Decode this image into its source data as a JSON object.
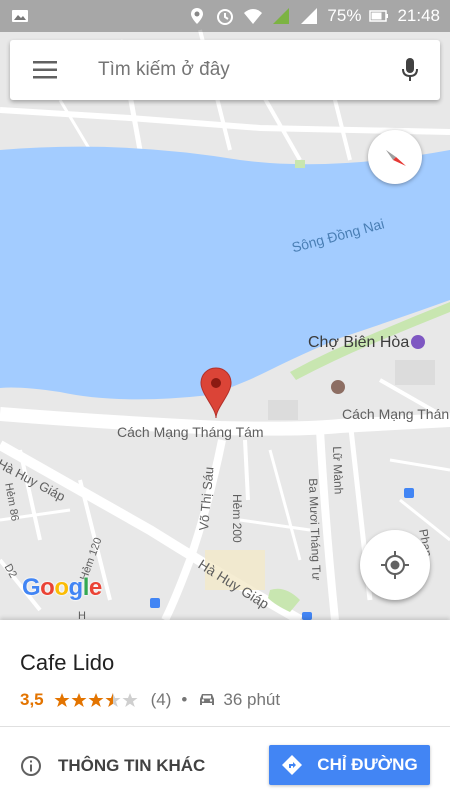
{
  "status_bar": {
    "battery": "75%",
    "time": "21:48"
  },
  "search": {
    "placeholder": "Tìm kiếm ở đây"
  },
  "map": {
    "labels": {
      "river": "Sông Đồng Nai",
      "market": "Chợ Biên Hòa",
      "street_cmt8_main": "Cách Mạng Tháng Tám",
      "street_cmt8_right": "Cách Mạng Thán",
      "street_ha_huy_giap_left": "Hà Huy Giáp",
      "street_ha_huy_giap_bottom": "Hà Huy Giáp",
      "street_vo_thi_sau": "Võ Thị Sáu",
      "alley_200": "Hẻm 200",
      "alley_86": "Hẻm 86",
      "alley_120": "Hẻm 120",
      "street_luu_manh": "Lữ Mành",
      "street_ba_muoi_thang_tu": "Ba Mươi Tháng Tư",
      "street_phan": "Phan",
      "road_d2": "D2",
      "road_h": "H"
    },
    "logo": "Google"
  },
  "place": {
    "name": "Cafe Lido",
    "rating": "3,5",
    "stars": 3.5,
    "reviews": "(4)",
    "separator": "•",
    "drive_time": "36 phút"
  },
  "actions": {
    "more_info": "THÔNG TIN KHÁC",
    "directions": "CHỈ ĐƯỜNG"
  },
  "colors": {
    "water": "#a3ccff",
    "land": "#e8e8e8",
    "road": "#ffffff",
    "accent": "#4285f4",
    "rating": "#e37400",
    "pin": "#db4437"
  }
}
